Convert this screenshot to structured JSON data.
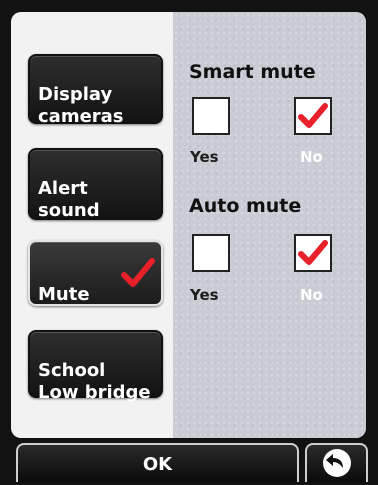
{
  "categories": [
    {
      "label": "Display\ncameras",
      "active": false
    },
    {
      "label": "Alert\nsound",
      "active": false
    },
    {
      "label": "Mute",
      "active": true
    },
    {
      "label": "School\nLow bridge",
      "active": false
    }
  ],
  "smart_mute": {
    "title": "Smart mute",
    "yes_label": "Yes",
    "no_label": "No",
    "selected": "No"
  },
  "auto_mute": {
    "title": "Auto mute",
    "yes_label": "Yes",
    "no_label": "No",
    "selected": "No"
  },
  "footer": {
    "ok_label": "OK"
  },
  "icons": {
    "checkmark": "checkmark-icon",
    "back": "back-arrow-icon"
  },
  "colors": {
    "check": "#e8202a",
    "button_dark": "#1a1a1a",
    "panel": "#c9ccd4"
  }
}
